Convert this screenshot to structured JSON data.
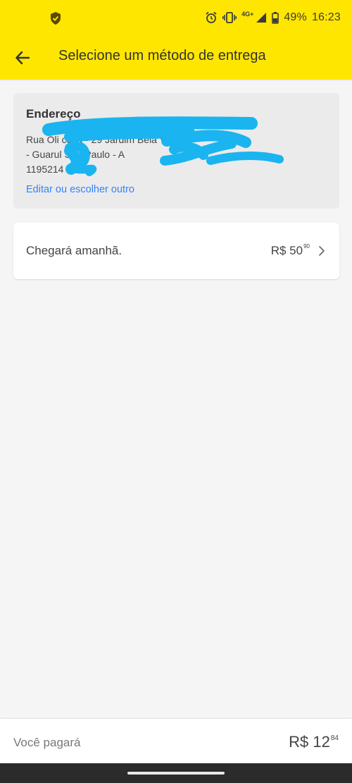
{
  "status_bar": {
    "network": "4G+",
    "battery": "49%",
    "time": "16:23"
  },
  "header": {
    "title": "Selecione um método de entrega"
  },
  "address": {
    "title": "Endereço",
    "line1": "Rua Oli        casa -              29 Jardim Bela Vista",
    "line2": "- Guarul      São Paulo - A",
    "line3": "1195214",
    "edit_link": "Editar ou escolher outro"
  },
  "shipping_option": {
    "label": "Chegará amanhã.",
    "price_main": "R$ 50",
    "price_cents": "90"
  },
  "footer": {
    "label": "Você pagará",
    "total_main": "R$ 12",
    "total_cents": "84"
  },
  "colors": {
    "brand_yellow": "#ffe600",
    "link_blue": "#3483fa",
    "redaction": "#1ab4f0"
  }
}
